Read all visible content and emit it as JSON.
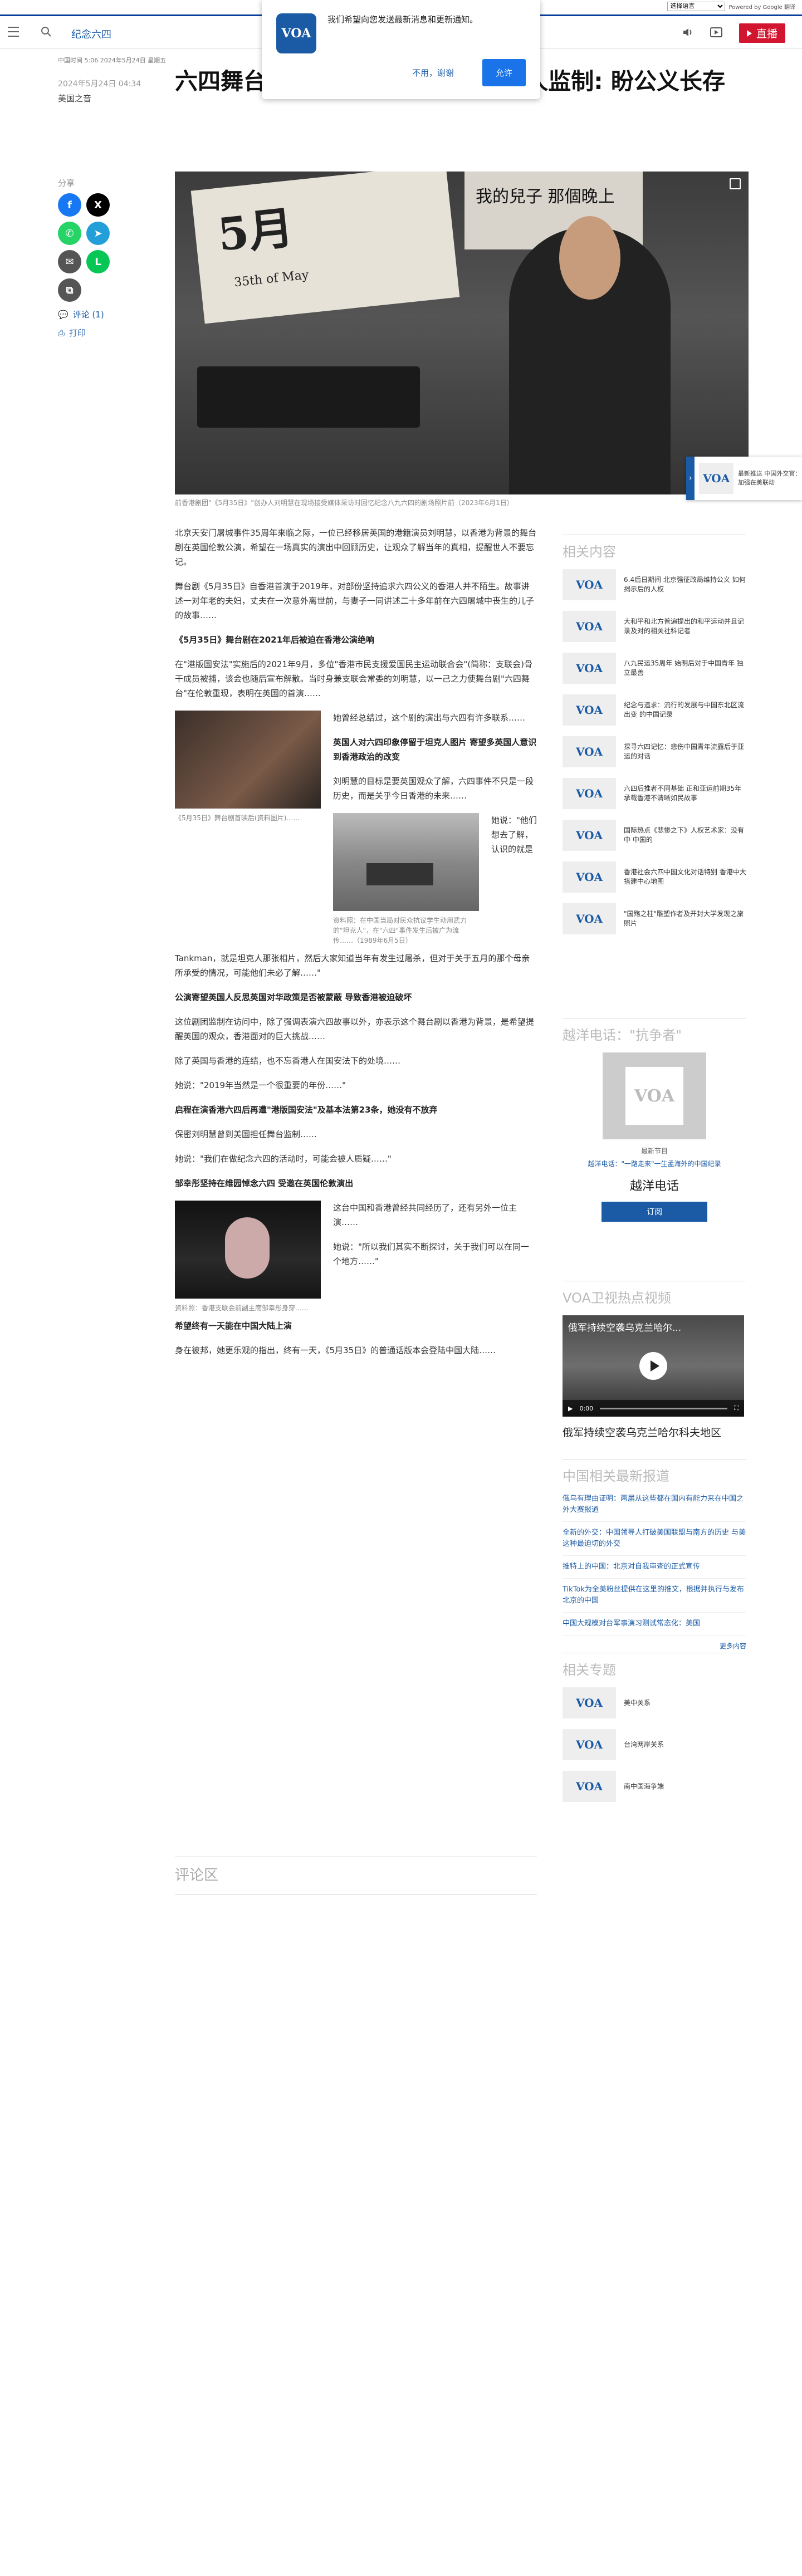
{
  "translate": {
    "select_label": "选择语言",
    "powered": "Powered by Google 翻译"
  },
  "header": {
    "section": "纪念六四",
    "live_label": "直播",
    "colors": {
      "accent": "#1b5ba6",
      "live": "#d2162f"
    }
  },
  "notification": {
    "message": "我们希望向您发送最新消息和更新通知。",
    "no": "不用，谢谢",
    "yes": "允许",
    "logo": "VOA"
  },
  "article": {
    "meta": "中国时间 5:06 2024年5月24日 星期五",
    "date": "2024年5月24日 04:34",
    "author": "美国之音",
    "title": "六四舞台剧香港以英国伦敦公演 港人监制: 盼公义长存",
    "hero_sign_big": "5月",
    "hero_sign_small": "35th of May",
    "hero_sign_right": "我的兒子 那個晚上",
    "hero_caption": "前香港剧团\"《5月35日》\"创办人刘明慧在现场接受媒体采访时回忆纪念八九六四的剧场照片前（2023年6月1日）",
    "paragraphs": [
      "北京天安门屠城事件35周年来临之际，一位已经移居英国的港籍演员刘明慧，以香港为背景的舞台剧在英国伦敦公演，希望在一场真实的演出中回顾历史，让观众了解当年的真相，提醒世人不要忘记。",
      "舞台剧《5月35日》自香港首演于2019年，对部份坚持追求六四公义的香港人并不陌生。故事讲述一对年老的夫妇，丈夫在一次意外离世前，与妻子一同讲述二十多年前在六四屠城中丧生的儿子的故事……",
      "《5月35日》舞台剧在2021年后被迫在香港公演绝响",
      "在\"港版国安法\"实施后的2021年9月，多位\"香港市民支援爱国民主运动联合会\"(简称：支联会)骨干成员被捕，该会也随后宣布解散。当时身兼支联会常委的刘明慧，以一己之力使舞台剧\"六四舞台\"在伦敦重现，表明在英国的首演……",
      "她曾经总结过，这个剧的演出与六四有许多联系……",
      "英国人对六四印象停留于坦克人图片 寄望多英国人意识到香港政治的改变",
      "刘明慧的目标是要英国观众了解，六四事件不只是一段历史，而是关乎今日香港的未来……",
      "她说：\"他们想去了解，认识的就是Tankman，就是坦克人那张相片，然后大家知道当年有发生过屠杀，但对于关于五月的那个母亲所承受的情况，可能他们未必了解……\"",
      "公演寄望英国人反思英国对华政策是否被蒙蔽 导致香港被迫破坏",
      "这位剧团监制在访问中，除了强调表演六四故事以外，亦表示这个舞台剧以香港为背景，是希望提醒英国的观众，香港面对的巨大挑战……",
      "除了英国与香港的连结，也不忘香港人在国安法下的处境……",
      "她说：\"2019年当然是一个很重要的年份……\"",
      "启程在演香港六四后再遭\"港版国安法\"及基本法第23条，她没有不放弃",
      "保密刘明慧曾到美国担任舞台监制……",
      "她说：\"我们在做纪念六四的活动时，可能会被人质疑……\"",
      "邹幸彤坚持在维园悼念六四 受邀在英国伦敦演出",
      "这台中国和香港曾经共同经历了，还有另外一位主演……",
      "她说：\"所以我们其实不断探讨，关于我们可以在同一个地方……\"",
      "希望终有一天能在中国大陆上演",
      "身在彼邦，她更乐观的指出，终有一天，《5月35日》的普通话版本会登陆中国大陆……"
    ],
    "img1_caption": "《5月35日》舞台剧首映后(资料图片)……",
    "img2_caption": "资料照：在中国当局对民众抗议学生动用武力的\"坦克人\"，在\"六四\"事件发生后被广为流传……（1989年6月5日）",
    "img3_caption": "资料照：香港支联会前副主席邹幸彤身穿……",
    "comments": "评论区"
  },
  "share": {
    "label": "分享",
    "comments": "评论 (1)",
    "print": "打印"
  },
  "sidebar": {
    "related_title": "相关内容",
    "related": [
      "6.4后日期间 北京强征政局维持公义 如何揭示后的人权",
      "大和平和北方普遍提出的和平运动并且记 录及对的相关社科记者",
      "八九民运35周年 始明后对于中国青年 独立最善",
      "纪念与追求：流行的发展与中国东北区流出变 的中国记录",
      "探寻六四记忆：悲伤中国青年流露后于亚运的对话",
      "六四后推者不同基础 正和亚运前期35年 承载香港不清晰如民故事",
      "国际热点《悲惨之下》人权艺术家：没有中 中国的",
      "香港社会六四中国文化对话特别 香港中大 搭建中心地图",
      "\"国殇之柱\"雕塑作者及开封大学发现之旅 照片"
    ],
    "podcast_title": "越洋电话：\"抗争者\"",
    "podcast_latest": "最新节目",
    "podcast_desc": "越洋电话：\"一路走来\"一生孟海外的中国纪录",
    "podcast_name": "越洋电话",
    "podcast_sub": "订阅",
    "video_title": "VOA卫视热点视频",
    "video_overlay": "俄军持续空袭乌克兰哈尔...",
    "video_time": "0:00",
    "video_caption": "俄军持续空袭乌克兰哈尔科夫地区",
    "news_title": "中国相关最新报道",
    "news": [
      "俄乌有理由证明：两届从这些都在国内有能力来在中国之外大赛报道",
      "全新的外交：中国领导人打破美国联盟与南方的历史 与美 这种最迫切的外交",
      "推特上的中国：北京对自我审查的正式宣传",
      "TikTok为全美粉丝提供在这里的推文，根据并执行与发布 北京的中国",
      "中国大规模对台军事演习测试常态化：美国"
    ],
    "more": "更多内容",
    "topics_title": "相关专题",
    "topics": [
      "美中关系",
      "台湾两岸关系",
      "南中国海争端"
    ],
    "float_text": "最新推送 中国外交官：加强在美联动"
  }
}
